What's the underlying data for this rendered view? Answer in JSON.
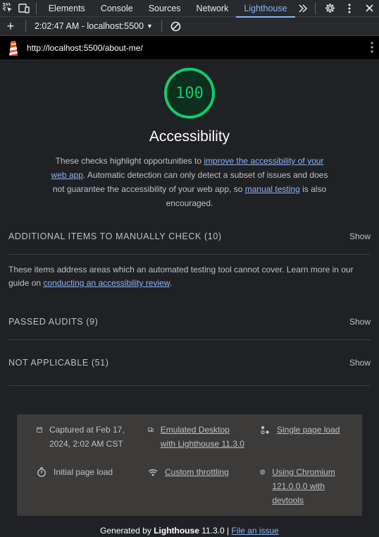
{
  "devtools": {
    "tabs": [
      "Elements",
      "Console",
      "Sources",
      "Network",
      "Lighthouse"
    ],
    "active_tab": "Lighthouse"
  },
  "toolbar": {
    "report_selector": "2:02:47 AM - localhost:5500"
  },
  "urlbar": {
    "url": "http://localhost:5500/about-me/"
  },
  "category": {
    "score": "100",
    "title": "Accessibility",
    "desc_part1": "These checks highlight opportunities to ",
    "desc_link1": "improve the accessibility of your web app",
    "desc_part2": ". Automatic detection can only detect a subset of issues and does not guarantee the accessibility of your web app, so ",
    "desc_link2": "manual testing",
    "desc_part3": " is also encouraged."
  },
  "groups": {
    "manual": {
      "title": "ADDITIONAL ITEMS TO MANUALLY CHECK (10)",
      "show": "Show",
      "desc_part1": "These items address areas which an automated testing tool cannot cover. Learn more in our guide on ",
      "desc_link": "conducting an accessibility review",
      "desc_part2": "."
    },
    "passed": {
      "title": "PASSED AUDITS (9)",
      "show": "Show"
    },
    "na": {
      "title": "NOT APPLICABLE (51)",
      "show": "Show"
    }
  },
  "info": {
    "captured": "Captured at Feb 17, 2024, 2:02 AM CST",
    "emulated": "Emulated Desktop with Lighthouse 11.3.0",
    "single_load": "Single page load",
    "initial_load": "Initial page load",
    "throttling": "Custom throttling",
    "chromium": "Using Chromium 121.0.0.0 with devtools"
  },
  "footer": {
    "generated_by": "Generated by ",
    "lighthouse": "Lighthouse",
    "version": " 11.3.0 | ",
    "file_issue": "File an issue"
  }
}
